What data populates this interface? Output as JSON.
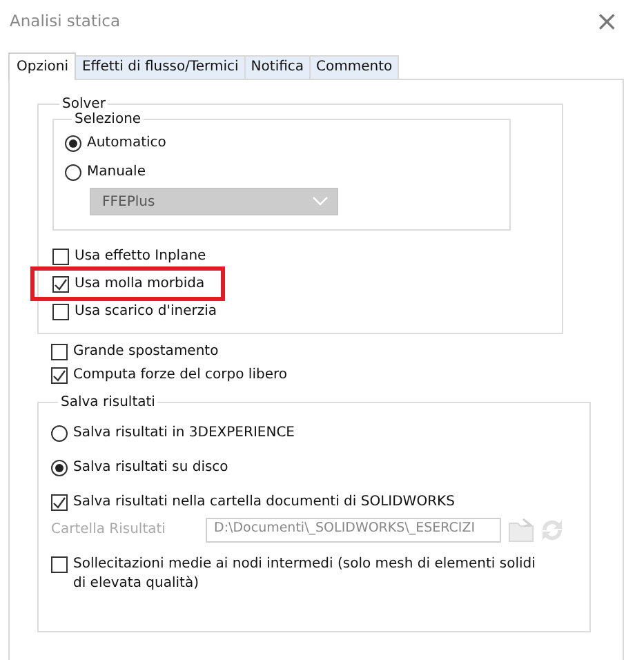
{
  "window": {
    "title": "Analisi statica",
    "close": "×"
  },
  "tabs": [
    {
      "label": "Opzioni",
      "selected": true
    },
    {
      "label": "Effetti di flusso/Termici",
      "selected": false
    },
    {
      "label": "Notifica",
      "selected": false
    },
    {
      "label": "Commento",
      "selected": false
    }
  ],
  "solver": {
    "title": "Solver",
    "selection": {
      "title": "Selezione",
      "options": [
        {
          "label": "Automatico",
          "selected": true
        },
        {
          "label": "Manuale",
          "selected": false
        }
      ],
      "dropdown": {
        "value": "FFEPlus",
        "disabled": true
      }
    },
    "checkboxes": [
      {
        "label": "Usa effetto Inplane",
        "checked": false,
        "highlighted": false
      },
      {
        "label": "Usa molla morbida",
        "checked": true,
        "highlighted": true
      },
      {
        "label": "Usa scarico d'inerzia",
        "checked": false,
        "highlighted": false
      }
    ]
  },
  "options": [
    {
      "label": "Grande spostamento",
      "checked": false
    },
    {
      "label": "Computa forze del corpo libero",
      "checked": true
    }
  ],
  "results": {
    "title": "Salva risultati",
    "items": [
      {
        "kind": "radio",
        "label": "Salva risultati in 3DEXPERIENCE",
        "selected": false
      },
      {
        "kind": "radio",
        "label": "Salva risultati su disco",
        "selected": true
      },
      {
        "kind": "checkbox",
        "label": "Salva risultati nella cartella documenti di SOLIDWORKS",
        "checked": true
      },
      {
        "kind": "folder",
        "label": "Cartella Risultati",
        "value": "D:\\Documenti\\_SOLIDWORKS\\_ESERCIZI",
        "disabled": true
      },
      {
        "kind": "checkbox",
        "label": "Sollecitazioni medie ai nodi intermedi (solo mesh di elementi solidi di elevata qualità)",
        "checked": false
      }
    ]
  }
}
